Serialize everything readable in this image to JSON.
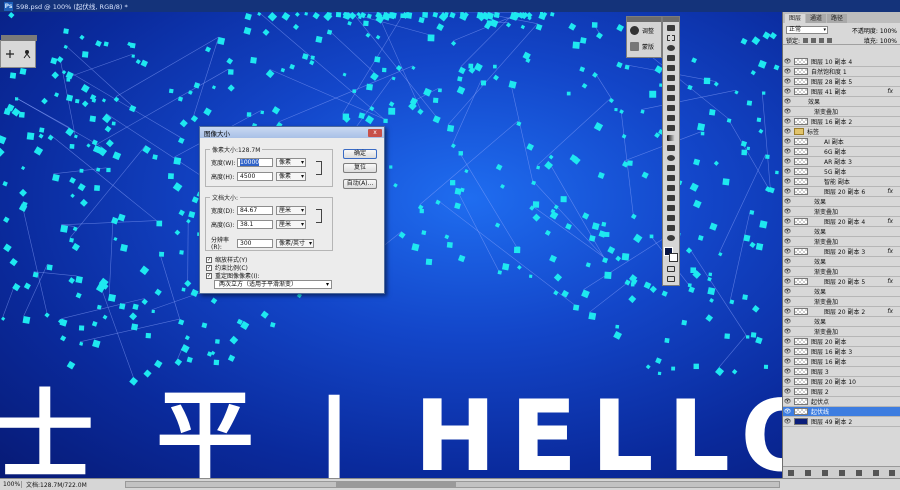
{
  "window": {
    "title": "598.psd @ 100% (起伏线, RGB/8) *",
    "app_icon": "Ps"
  },
  "canvas": {
    "headline": "士 平 | HELLO"
  },
  "adjust_panel": {
    "items": [
      {
        "label": "调整",
        "icon": "adjust-icon"
      },
      {
        "label": "蒙版",
        "icon": "mask-icon"
      }
    ]
  },
  "dialog": {
    "title": "图像大小",
    "close_label": "x",
    "pixel_dims_label": "像素大小:128.7M",
    "width_label": "宽度(W):",
    "width_value": "10000",
    "width_unit": "像素",
    "height_label": "高度(H):",
    "height_value": "4500",
    "height_unit": "像素",
    "doc_size_label": "文档大小:",
    "doc_width_label": "宽度(D):",
    "doc_width_value": "84.67",
    "doc_width_unit": "厘米",
    "doc_height_label": "高度(G):",
    "doc_height_value": "38.1",
    "doc_height_unit": "厘米",
    "resolution_label": "分辨率(R):",
    "resolution_value": "300",
    "resolution_unit": "像素/英寸",
    "ok_label": "确定",
    "reset_label": "复位",
    "auto_label": "自动(A)...",
    "scale_styles_label": "缩放样式(Y)",
    "constrain_label": "约束比例(C)",
    "resample_label": "重定图像像素(I):",
    "resample_method": "两次立方（适用于平滑渐变）"
  },
  "layers_panel": {
    "tabs": [
      "图层",
      "通道",
      "路径"
    ],
    "blend_mode": "正常",
    "opacity_label": "不透明度: 100%",
    "lock_label": "锁定:",
    "fill_label": "填充: 100%",
    "rows": [
      {
        "name": "图层 10 副本 4",
        "thumb": "checker",
        "fx": "",
        "indent": "",
        "selected": false
      },
      {
        "name": "自然饱和度 1",
        "thumb": "checker",
        "fx": "",
        "indent": "",
        "selected": false
      },
      {
        "name": "图层 28 副本 5",
        "thumb": "checker",
        "fx": "",
        "indent": "",
        "selected": false
      },
      {
        "name": "图层 41 副本",
        "thumb": "checker",
        "fx": "fx",
        "indent": "",
        "selected": false
      },
      {
        "name": "效果",
        "thumb": "none",
        "fx": "",
        "indent": "sub",
        "selected": false
      },
      {
        "name": "渐变叠加",
        "thumb": "none",
        "fx": "",
        "indent": "sub2",
        "selected": false
      },
      {
        "name": "图层 16 副本 2",
        "thumb": "checker",
        "fx": "",
        "indent": "",
        "selected": false
      },
      {
        "name": "标签",
        "thumb": "folder",
        "fx": "",
        "indent": "",
        "selected": false
      },
      {
        "name": "AI 副本",
        "thumb": "checker",
        "fx": "",
        "indent": "sub",
        "selected": false
      },
      {
        "name": "6G 副本",
        "thumb": "checker",
        "fx": "",
        "indent": "sub",
        "selected": false
      },
      {
        "name": "AR 副本 3",
        "thumb": "checker",
        "fx": "",
        "indent": "sub",
        "selected": false
      },
      {
        "name": "5G 副本",
        "thumb": "checker",
        "fx": "",
        "indent": "sub",
        "selected": false
      },
      {
        "name": "智能 副本",
        "thumb": "checker",
        "fx": "",
        "indent": "sub",
        "selected": false
      },
      {
        "name": "图层 20 副本 6",
        "thumb": "checker",
        "fx": "fx",
        "indent": "sub",
        "selected": false
      },
      {
        "name": "效果",
        "thumb": "none",
        "fx": "",
        "indent": "sub2",
        "selected": false
      },
      {
        "name": "渐变叠加",
        "thumb": "none",
        "fx": "",
        "indent": "sub2",
        "selected": false
      },
      {
        "name": "图层 20 副本 4",
        "thumb": "checker",
        "fx": "fx",
        "indent": "sub",
        "selected": false
      },
      {
        "name": "效果",
        "thumb": "none",
        "fx": "",
        "indent": "sub2",
        "selected": false
      },
      {
        "name": "渐变叠加",
        "thumb": "none",
        "fx": "",
        "indent": "sub2",
        "selected": false
      },
      {
        "name": "图层 20 副本 3",
        "thumb": "checker",
        "fx": "fx",
        "indent": "sub",
        "selected": false
      },
      {
        "name": "效果",
        "thumb": "none",
        "fx": "",
        "indent": "sub2",
        "selected": false
      },
      {
        "name": "渐变叠加",
        "thumb": "none",
        "fx": "",
        "indent": "sub2",
        "selected": false
      },
      {
        "name": "图层 20 副本 5",
        "thumb": "checker",
        "fx": "fx",
        "indent": "sub",
        "selected": false
      },
      {
        "name": "效果",
        "thumb": "none",
        "fx": "",
        "indent": "sub2",
        "selected": false
      },
      {
        "name": "渐变叠加",
        "thumb": "none",
        "fx": "",
        "indent": "sub2",
        "selected": false
      },
      {
        "name": "图层 20 副本 2",
        "thumb": "checker",
        "fx": "fx",
        "indent": "sub",
        "selected": false
      },
      {
        "name": "效果",
        "thumb": "none",
        "fx": "",
        "indent": "sub2",
        "selected": false
      },
      {
        "name": "渐变叠加",
        "thumb": "none",
        "fx": "",
        "indent": "sub2",
        "selected": false
      },
      {
        "name": "图层 20 副本",
        "thumb": "checker",
        "fx": "",
        "indent": "",
        "selected": false
      },
      {
        "name": "图层 16 副本 3",
        "thumb": "checker",
        "fx": "",
        "indent": "",
        "selected": false
      },
      {
        "name": "图层 16 副本",
        "thumb": "checker",
        "fx": "",
        "indent": "",
        "selected": false
      },
      {
        "name": "图层 3",
        "thumb": "checker",
        "fx": "",
        "indent": "",
        "selected": false
      },
      {
        "name": "图层 20 副本 10",
        "thumb": "checker",
        "fx": "",
        "indent": "",
        "selected": false
      },
      {
        "name": "图层 2",
        "thumb": "checker",
        "fx": "",
        "indent": "",
        "selected": false
      },
      {
        "name": "起伏点",
        "thumb": "checker",
        "fx": "",
        "indent": "",
        "selected": false
      },
      {
        "name": "起伏线",
        "thumb": "checker",
        "fx": "",
        "indent": "",
        "selected": true
      },
      {
        "name": "图层 49 副本 2",
        "thumb": "dark",
        "fx": "",
        "indent": "",
        "selected": false
      }
    ]
  },
  "statusbar": {
    "zoom": "100%",
    "doc_info": "文档:128.7M/722.0M"
  },
  "colors": {
    "canvas_bg": "#1346c9",
    "particle": "#1ee8f0",
    "selection": "#3d7de0"
  }
}
